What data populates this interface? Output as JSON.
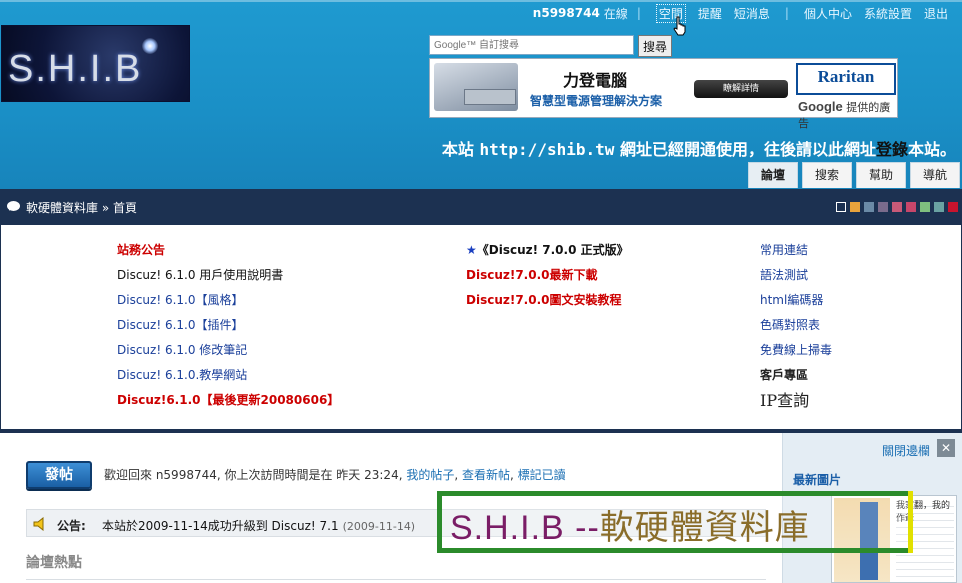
{
  "topbar": {
    "username": "n5998744",
    "online_status": "在線",
    "links": [
      "空間",
      "提醒",
      "短消息",
      "個人中心",
      "系統設置",
      "退出"
    ]
  },
  "logo": {
    "text": "S.H.I.B"
  },
  "search": {
    "placeholder": "Google™ 自訂搜尋",
    "button_label": "搜尋"
  },
  "ad": {
    "title": "力登電腦",
    "subtitle": "智慧型電源管理解決方案",
    "button_label": "瞭解詳情",
    "brand": "Raritan",
    "google_text": "提供的廣告",
    "google_brand": "Google"
  },
  "notice": {
    "prefix": "本站",
    "url": "http://shib.tw",
    "middle": "網址已經開通使用，往後請以此網址",
    "login": "登錄",
    "suffix": "本站。"
  },
  "tabs": [
    "論壇",
    "搜索",
    "幫助",
    "導航"
  ],
  "navbar": {
    "breadcrumb": "軟硬體資料庫 » 首頁",
    "swatch_colors": [
      "#ffffff",
      "#e8a33c",
      "#6b8aa6",
      "#7a6b8c",
      "#c85a78",
      "#c8466a",
      "#7fbf7f",
      "#6aa2a2",
      "#c8142e"
    ]
  },
  "links": {
    "col1": [
      {
        "text": "站務公告",
        "style": "red-bold"
      },
      {
        "text": "Discuz! 6.1.0 用戶使用說明書",
        "style": "black"
      },
      {
        "text": "Discuz! 6.1.0【風格】",
        "style": "blue"
      },
      {
        "text": "Discuz! 6.1.0【插件】",
        "style": "blue"
      },
      {
        "text": "Discuz! 6.1.0 修改筆記",
        "style": "blue"
      },
      {
        "text": "Discuz! 6.1.0.教學網站",
        "style": "blue"
      },
      {
        "text": "Discuz!6.1.0【最後更新20080606】",
        "style": "red-bold"
      }
    ],
    "col2": [
      {
        "text": "★《Discuz! 7.0.0 正式版》",
        "style": "black-bold"
      },
      {
        "text": "Discuz!7.0.0最新下載",
        "style": "red-bold"
      },
      {
        "text": "Discuz!7.0.0圖文安裝教程",
        "style": "red-bold"
      }
    ],
    "col3": [
      {
        "text": "常用連結",
        "style": "blue"
      },
      {
        "text": "語法測試",
        "style": "blue"
      },
      {
        "text": "html編碼器",
        "style": "blue"
      },
      {
        "text": "色碼對照表",
        "style": "blue"
      },
      {
        "text": "免費線上掃毒",
        "style": "blue"
      },
      {
        "text": "客戶專區",
        "style": "tiny-bold"
      },
      {
        "text": "IP查詢",
        "style": "big"
      }
    ]
  },
  "main": {
    "post_button": "發帖",
    "welcome_text": "歡迎回來 n5998744, 你上次訪問時間是在 昨天 23:24,",
    "welcome_links": [
      "我的帖子",
      "查看新帖",
      "標記已讀"
    ],
    "announce_label": "公告:",
    "announce_text": "本站於2009-11-14成功升級到 Discuz! 7.1",
    "announce_date": "(2009-11-14)",
    "hot_title": "論壇熱點"
  },
  "sidebar": {
    "close_label": "關閉邊欄",
    "close_x": "✕",
    "latest_label": "最新圖片",
    "thumb_caption": "我家翻，我的作爺"
  },
  "watermark": {
    "latin": "S.H.I.B --",
    "cjk": "軟硬體資料庫"
  }
}
